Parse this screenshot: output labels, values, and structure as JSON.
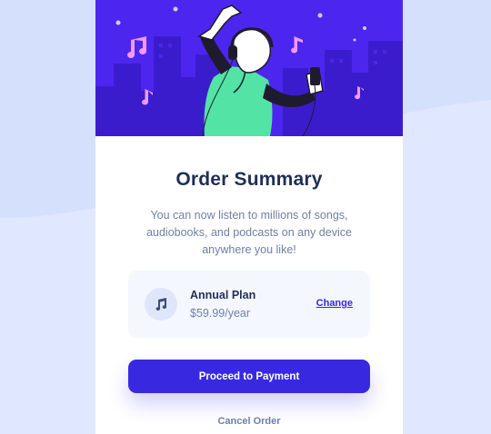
{
  "colors": {
    "page_background": "#e0e8ff",
    "card_background": "#ffffff",
    "accent": "#3829e0",
    "heading": "#1f2f56",
    "muted_text": "#7080a5",
    "plan_background": "#f5f7ff"
  },
  "hero": {
    "illustration": "dancing-person-with-headphones-and-music-notes-over-city-skyline",
    "icon_names": [
      "music-note-icon",
      "headphones-icon",
      "phone-icon"
    ]
  },
  "summary": {
    "title": "Order Summary",
    "description": "You can now listen to millions of songs, audiobooks, and podcasts on any device anywhere you like!"
  },
  "plan": {
    "icon": "music-note-icon",
    "name": "Annual Plan",
    "price": "$59.99/year",
    "change_label": "Change"
  },
  "actions": {
    "pay_label": "Proceed to Payment",
    "cancel_label": "Cancel Order"
  }
}
